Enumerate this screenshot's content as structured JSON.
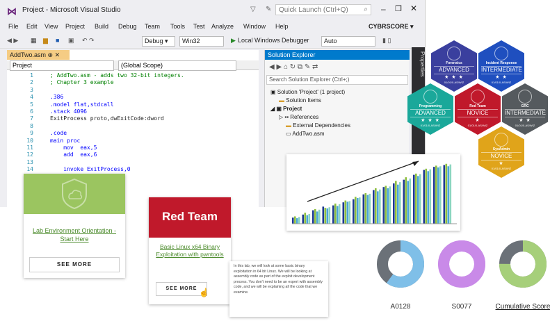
{
  "vs": {
    "title": "Project - Microsoft Visual Studio",
    "quick_launch": "Quick Launch (Ctrl+Q)",
    "user": "CYBRSCORE ▾",
    "menu": [
      "File",
      "Edit",
      "View",
      "Project",
      "Build",
      "Debug",
      "Team",
      "Tools",
      "Test",
      "Analyze",
      "Window",
      "Help"
    ],
    "toolbar": {
      "config": "Debug",
      "platform": "Win32",
      "debugger": "Local Windows Debugger",
      "mode": "Auto"
    },
    "editor": {
      "tab": "AddTwo.asm",
      "scope_left": "Project",
      "scope_right": "(Global Scope)",
      "lines": [
        {
          "n": "1",
          "t": "; AddTwo.asm - adds two 32-bit integers."
        },
        {
          "n": "2",
          "t": "; Chapter 3 example"
        },
        {
          "n": "3",
          "t": ""
        },
        {
          "n": "4",
          "t": ".386"
        },
        {
          "n": "5",
          "t": ".model flat,stdcall"
        },
        {
          "n": "6",
          "t": ".stack 4096"
        },
        {
          "n": "7",
          "t": "ExitProcess proto,dwExitCode:dword"
        },
        {
          "n": "8",
          "t": ""
        },
        {
          "n": "9",
          "t": ".code"
        },
        {
          "n": "10",
          "t": "main proc"
        },
        {
          "n": "11",
          "t": "    mov  eax,5"
        },
        {
          "n": "12",
          "t": "    add  eax,6"
        },
        {
          "n": "13",
          "t": ""
        },
        {
          "n": "14",
          "t": "    invoke ExitProcess,0"
        }
      ]
    },
    "solution": {
      "title": "Solution Explorer",
      "search": "Search Solution Explorer (Ctrl+;)",
      "items": [
        "Solution 'Project' (1 project)",
        "Solution Items",
        "Project",
        "References",
        "External Dependencies",
        "AddTwo.asm"
      ],
      "properties": "Properties"
    }
  },
  "cards": {
    "lab": {
      "link": "Lab Environment Orientation - Start Here",
      "button": "SEE MORE"
    },
    "redteam": {
      "banner": "Red Team",
      "link": "Basic Linux x64 Binary Exploitation with pwntools",
      "button": "SEE MORE"
    },
    "tooltip": "In this lab, we will look at some basic binary exploitation in 64 bit Linux. We will be looking at assembly code as part of the exploit development process. You don't need to be an expert with assembly code, and we will be explaining all the code that we examine."
  },
  "badges": [
    {
      "cat": "Forensics",
      "level": "ADVANCED",
      "stars": "★ ★ ★",
      "date": "01/01/0-AS/WIZ",
      "color": "#3a3f9e"
    },
    {
      "cat": "Incident Response",
      "level": "INTERMEDIATE",
      "stars": "★ ★",
      "date": "01/01/0-AS/WIZ",
      "color": "#1f4fbf"
    },
    {
      "cat": "Programming",
      "level": "ADVANCED",
      "stars": "★ ★ ★",
      "date": "01/01/0-AS/WIZ",
      "color": "#1aa89a"
    },
    {
      "cat": "Red Team",
      "level": "NOVICE",
      "stars": "★",
      "date": "01/01/0-AS/WIZ",
      "color": "#c0192b"
    },
    {
      "cat": "GRC",
      "level": "INTERMEDIATE",
      "stars": "★ ★",
      "date": "01/01/0-AS/WIZ",
      "color": "#555a5e"
    },
    {
      "cat": "SysAdmin",
      "level": "NOVICE",
      "stars": "★",
      "date": "01/01/0-AS/WIZ",
      "color": "#e0a41a"
    }
  ],
  "chart_data": {
    "type": "bar",
    "categories": [
      "1",
      "2",
      "3",
      "4",
      "5",
      "6",
      "7",
      "8",
      "9",
      "10",
      "11",
      "12",
      "13",
      "14",
      "15",
      "16"
    ],
    "series": [
      {
        "values": [
          10,
          15,
          22,
          28,
          30,
          35,
          40,
          48,
          55,
          60,
          66,
          72,
          80,
          88,
          93,
          96
        ]
      },
      {
        "values": [
          12,
          18,
          24,
          26,
          33,
          38,
          44,
          50,
          58,
          62,
          70,
          76,
          82,
          90,
          95,
          98
        ]
      },
      {
        "values": [
          9,
          14,
          20,
          25,
          29,
          36,
          42,
          47,
          53,
          58,
          64,
          70,
          78,
          86,
          92,
          94
        ]
      },
      {
        "values": [
          11,
          16,
          23,
          27,
          32,
          37,
          43,
          49,
          56,
          61,
          68,
          74,
          81,
          89,
          94,
          97
        ]
      }
    ],
    "colors": [
      "#1f3a93",
      "#8fbf3f",
      "#4aa7d8",
      "#8cd6c0"
    ],
    "ylim": [
      0,
      100
    ],
    "trend": "up"
  },
  "donuts": [
    {
      "label": "A0128",
      "fill": 0.6,
      "color": "#7fbfe8",
      "rest": "#6b7178"
    },
    {
      "label": "S0077",
      "fill": 1.0,
      "color": "#c98ae8",
      "rest": "#c98ae8"
    },
    {
      "label": "Cumulative Score",
      "fill": 0.75,
      "color": "#a6cf7a",
      "rest": "#6b7178"
    }
  ]
}
